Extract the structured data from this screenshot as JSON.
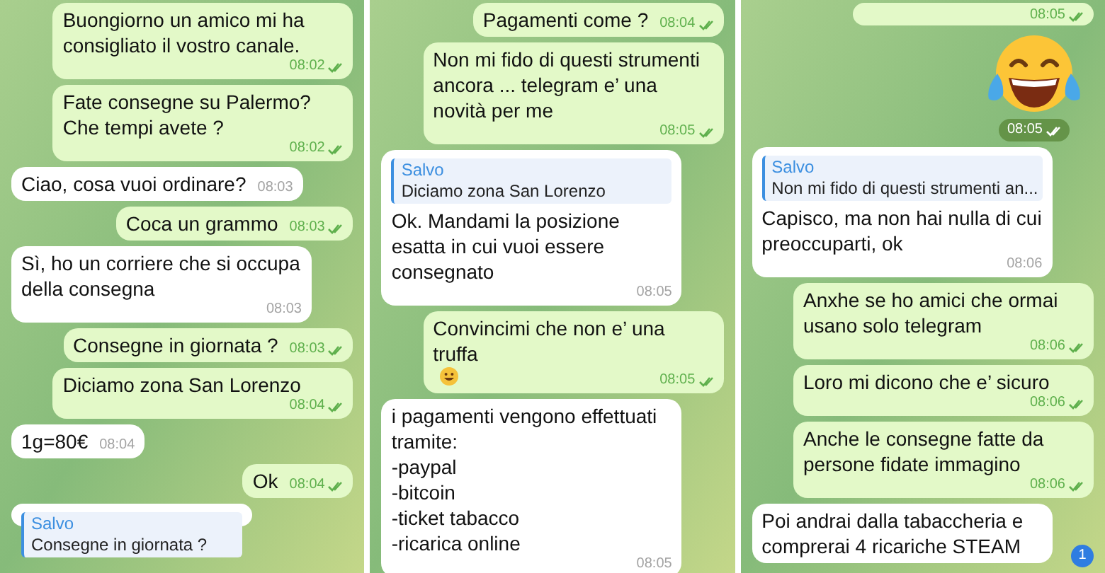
{
  "columns": [
    {
      "messages": [
        {
          "kind": "out",
          "text": "Buongiorno un amico mi ha consigliato il vostro canale.",
          "time": "08:02",
          "read": true
        },
        {
          "kind": "out",
          "text": "Fate consegne su Palermo? Che tempi avete ?",
          "time": "08:02",
          "read": true
        },
        {
          "kind": "in",
          "text": "Ciao, cosa vuoi ordinare?",
          "time": "08:03"
        },
        {
          "kind": "out",
          "text": "Coca un grammo",
          "time": "08:03",
          "read": true
        },
        {
          "kind": "in",
          "text": "Sì, ho un corriere che si occupa della consegna",
          "time": "08:03"
        },
        {
          "kind": "out",
          "text": "Consegne in giornata ?",
          "time": "08:03",
          "read": true
        },
        {
          "kind": "out",
          "text": "Diciamo zona San Lorenzo",
          "time": "08:04",
          "read": true
        },
        {
          "kind": "in",
          "text": "1g=80€",
          "time": "08:04"
        },
        {
          "kind": "out",
          "text": "Ok",
          "time": "08:04",
          "read": true
        },
        {
          "kind": "in",
          "reply": {
            "author": "Salvo",
            "text": "Consegne in giornata ?"
          }
        }
      ]
    },
    {
      "messages": [
        {
          "kind": "out",
          "text": "Pagamenti come ?",
          "time": "08:04",
          "read": true
        },
        {
          "kind": "out",
          "text": "Non mi fido di questi strumenti ancora ... telegram e’ una novità per me",
          "time": "08:05",
          "read": true
        },
        {
          "kind": "in",
          "reply": {
            "author": "Salvo",
            "text": "Diciamo zona San Lorenzo"
          },
          "text": "Ok. Mandami la posizione esatta in cui vuoi essere consegnato",
          "time": "08:05"
        },
        {
          "kind": "out",
          "text": "Convincimi che non e’ una truffa",
          "smiley": true,
          "time": "08:05",
          "read": true
        },
        {
          "kind": "in",
          "text": "i pagamenti vengono effettuati tramite:\n-paypal\n-bitcoin\n-ticket tabacco\n-ricarica online",
          "time": "08:05"
        }
      ]
    },
    {
      "messages": [
        {
          "kind": "out",
          "time": "08:05",
          "read": true
        },
        {
          "kind": "emoji",
          "time": "08:05",
          "read": true
        },
        {
          "kind": "in",
          "reply": {
            "author": "Salvo",
            "text": "Non mi fido di questi strumenti an..."
          },
          "text": "Capisco, ma non hai nulla di cui preoccuparti, ok",
          "time": "08:06"
        },
        {
          "kind": "out",
          "text": "Anxhe se ho amici che ormai usano solo telegram",
          "time": "08:06",
          "read": true
        },
        {
          "kind": "out",
          "text": "Loro mi dicono che e’ sicuro",
          "time": "08:06",
          "read": true
        },
        {
          "kind": "out",
          "text": "Anche le consegne fatte da persone fidate immagino",
          "time": "08:06",
          "read": true
        },
        {
          "kind": "in",
          "text": "Poi andrai dalla tabaccheria e comprerai 4 ricariche STEAM"
        }
      ],
      "unread_badge": "1"
    }
  ]
}
